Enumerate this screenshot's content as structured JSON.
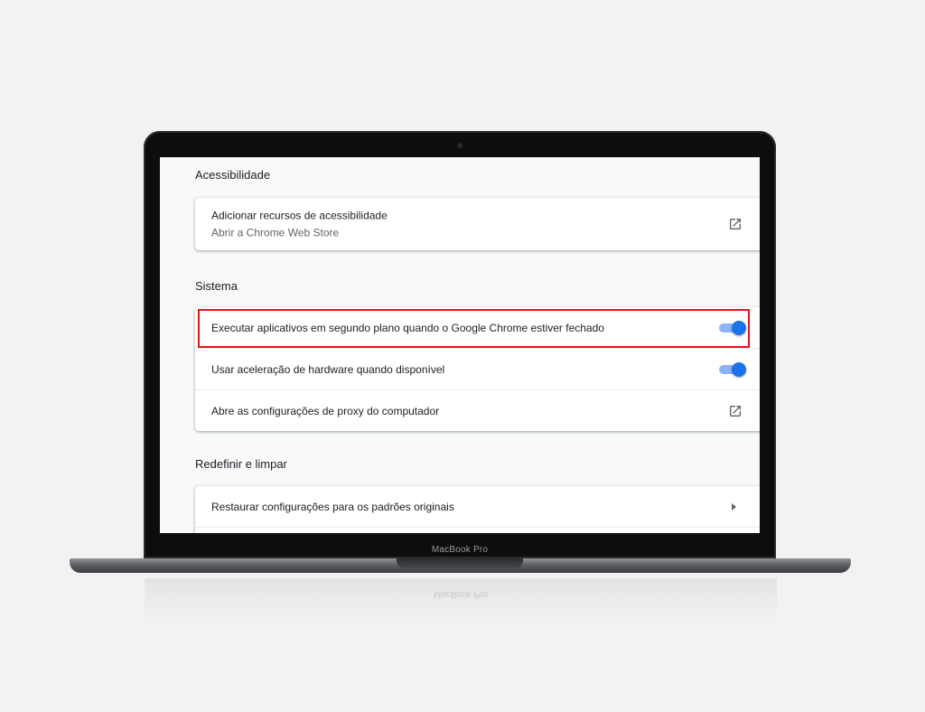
{
  "device": {
    "brand_label": "MacBook Pro"
  },
  "settings": {
    "accessibility": {
      "title": "Acessibilidade",
      "add_features": {
        "label": "Adicionar recursos de acessibilidade",
        "sublabel": "Abrir a Chrome Web Store",
        "icon": "open-in-new-icon"
      }
    },
    "system": {
      "title": "Sistema",
      "background_apps": {
        "label": "Executar aplicativos em segundo plano quando o Google Chrome estiver fechado",
        "enabled": true,
        "highlighted": true
      },
      "hardware_acceleration": {
        "label": "Usar aceleração de hardware quando disponível",
        "enabled": true
      },
      "proxy": {
        "label": "Abre as configurações de proxy do computador",
        "icon": "open-in-new-icon"
      }
    },
    "reset": {
      "title": "Redefinir e limpar",
      "restore": {
        "label": "Restaurar configurações para os padrões originais",
        "icon": "chevron-right-icon"
      }
    }
  },
  "colors": {
    "toggle_on": "#1a73e8",
    "toggle_track_on": "#8ab4f8",
    "highlight_border": "#e0151b"
  }
}
